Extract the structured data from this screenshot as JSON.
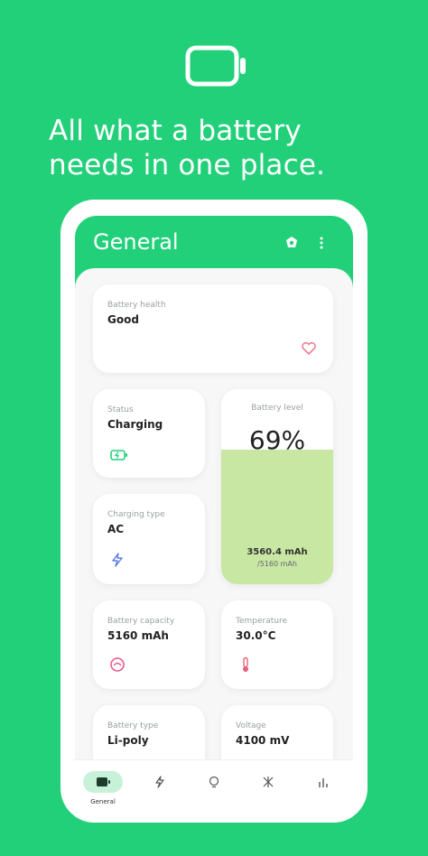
{
  "headline": {
    "line1": "All what a battery",
    "line2": "needs in one place."
  },
  "colors": {
    "brand_green": "#22d07a",
    "level_fill": "#c8e7a2",
    "nav_pill": "#c7f1d8"
  },
  "appbar": {
    "title": "General"
  },
  "cards": {
    "health": {
      "label": "Battery health",
      "value": "Good",
      "icon": "heart-icon"
    },
    "status": {
      "label": "Status",
      "value": "Charging",
      "icon": "battery-charging-icon"
    },
    "charging_type": {
      "label": "Charging type",
      "value": "AC",
      "icon": "bolt-icon"
    },
    "capacity": {
      "label": "Battery capacity",
      "value": "5160 mAh",
      "icon": "gauge-icon"
    },
    "temperature": {
      "label": "Temperature",
      "value": "30.0°C",
      "icon": "thermometer-icon"
    },
    "type": {
      "label": "Battery type",
      "value": "Li-poly",
      "icon": "chip-icon"
    },
    "voltage": {
      "label": "Voltage",
      "value": "4100 mV",
      "icon": "voltage-icon"
    }
  },
  "level": {
    "label": "Battery level",
    "percent_text": "69%",
    "percent_value": 69,
    "mah": "3560.4 mAh",
    "total": "/5160 mAh"
  },
  "navbar": {
    "items": [
      {
        "label": "General",
        "icon": "battery-icon",
        "active": true
      },
      {
        "label": "",
        "icon": "bolt-icon"
      },
      {
        "label": "",
        "icon": "lightbulb-icon"
      },
      {
        "label": "",
        "icon": "tools-icon"
      },
      {
        "label": "",
        "icon": "bar-chart-icon"
      }
    ]
  }
}
